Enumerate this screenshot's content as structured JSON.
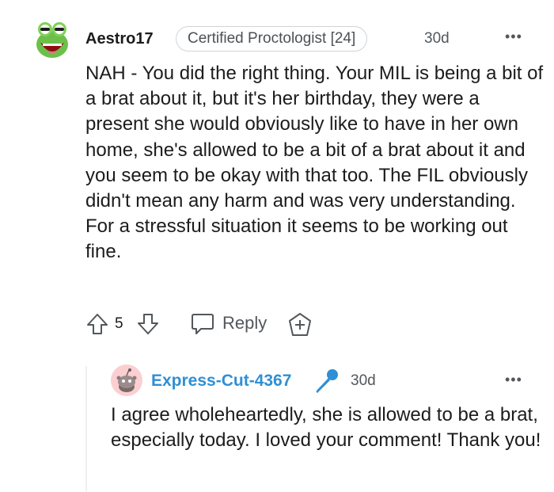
{
  "comment": {
    "username": "Aestro17",
    "flair": "Certified Proctologist [24]",
    "time": "30d",
    "more": "•••",
    "body": "NAH - You did the right thing. Your MIL is being a bit of a brat about it, but it's her birthday, they were a present she would obviously like to have in her own home, she's allowed to be a bit of a brat about it and you seem to be okay with that too. The FIL obviously didn't mean any harm and was very understanding. For a stressful situation it seems to be working out fine.",
    "score": "5",
    "reply_label": "Reply",
    "avatar_icon": "kermit-avatar",
    "upvote_icon": "upvote-icon",
    "downvote_icon": "downvote-icon",
    "reply_icon": "speech-bubble-icon",
    "award_icon": "award-icon"
  },
  "reply": {
    "username": "Express-Cut-4367",
    "time": "30d",
    "more": "•••",
    "body": "I agree wholeheartedly, she is allowed to be a brat, especially today. I loved your comment! Thank you!",
    "avatar_icon": "snoo-avatar",
    "badge_icon": "microphone-icon"
  },
  "colors": {
    "text": "#1c1c1c",
    "meta": "#52575b",
    "reply_username": "#2f8fd4",
    "thread_line": "#edeff1",
    "snoo_bg": "#fbcfd2"
  }
}
